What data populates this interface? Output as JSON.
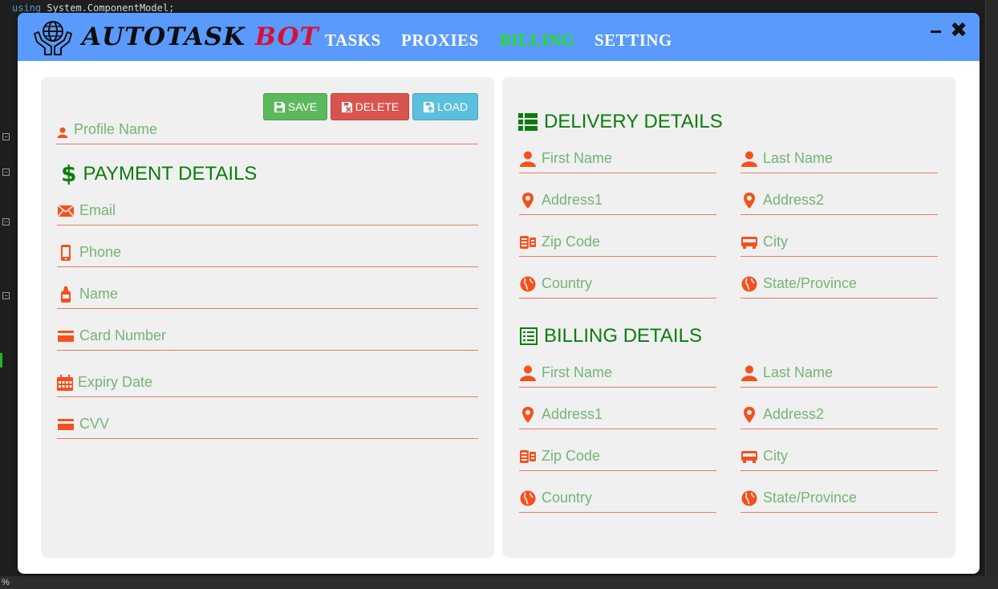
{
  "editor": {
    "code_keyword": "using",
    "code_text": " System.ComponentModel;",
    "status_zoom": "%"
  },
  "app": {
    "logo_text_1": "AUTOTASK",
    "logo_text_2": "BOT",
    "nav": [
      {
        "label": "TASKS",
        "active": false
      },
      {
        "label": "PROXIES",
        "active": false
      },
      {
        "label": "BILLING",
        "active": true
      },
      {
        "label": "SETTING",
        "active": false
      }
    ],
    "close_glyph": "✖"
  },
  "colors": {
    "title_bar": "#5a9afc",
    "accent_green": "#0b7d0b",
    "active_nav": "#22dd22",
    "icon_orange": "#f4511e",
    "save": "#5cb85c",
    "delete": "#d9534f",
    "load": "#5bc0de"
  },
  "buttons": {
    "save": "SAVE",
    "delete": "DELETE",
    "load": "LOAD"
  },
  "profile": {
    "placeholder": "Profile Name",
    "value": ""
  },
  "payment": {
    "title": "PAYMENT DETAILS",
    "fields": {
      "email": {
        "placeholder": "Email",
        "icon": "envelope-icon"
      },
      "phone": {
        "placeholder": "Phone",
        "icon": "phone-icon"
      },
      "name": {
        "placeholder": "Name",
        "icon": "bottle-icon"
      },
      "card": {
        "placeholder": "Card Number",
        "icon": "credit-card-icon"
      },
      "expiry": {
        "placeholder": "Expiry Date",
        "icon": "calendar-icon"
      },
      "cvv": {
        "placeholder": "CVV",
        "icon": "credit-card-icon"
      }
    }
  },
  "delivery": {
    "title": "DELIVERY DETAILS",
    "first_name": "First Name",
    "last_name": "Last Name",
    "address1": "Address1",
    "address2": "Address2",
    "zip": "Zip Code",
    "city": "City",
    "country": "Country",
    "state": "State/Province"
  },
  "billing": {
    "title": "BILLING DETAILS",
    "first_name": "First Name",
    "last_name": "Last Name",
    "address1": "Address1",
    "address2": "Address2",
    "zip": "Zip Code",
    "city": "City",
    "country": "Country",
    "state": "State/Province"
  }
}
